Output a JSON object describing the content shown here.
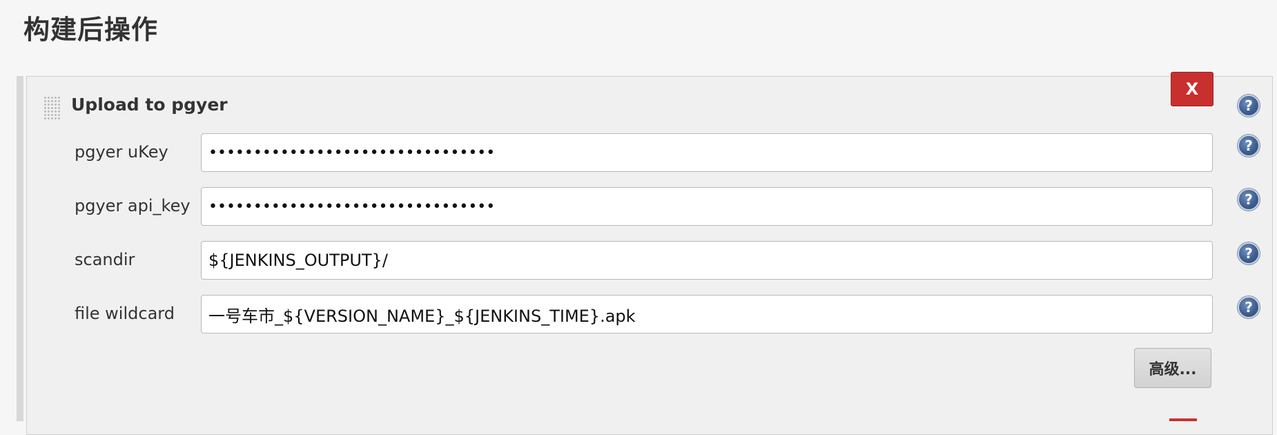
{
  "section": {
    "title": "构建后操作"
  },
  "step": {
    "title": "Upload to pgyer",
    "delete_label": "X",
    "help_glyph": "?",
    "advanced_label": "高级...",
    "fields": [
      {
        "label": "pgyer uKey",
        "value": "••••••••••••••••••••••••••••••••",
        "type": "password"
      },
      {
        "label": "pgyer api_key",
        "value": "••••••••••••••••••••••••••••••••",
        "type": "password"
      },
      {
        "label": "scandir",
        "value": "${JENKINS_OUTPUT}/",
        "type": "text"
      },
      {
        "label": "file wildcard",
        "value": "一号车市_${VERSION_NAME}_${JENKINS_TIME}.apk",
        "type": "text"
      }
    ]
  },
  "colors": {
    "delete_button": "#c8302f",
    "help_icon": "#3f5f91",
    "panel_bg": "#f0f0f0"
  },
  "icons": {
    "help": "help-icon",
    "drag": "drag-handle-icon"
  }
}
